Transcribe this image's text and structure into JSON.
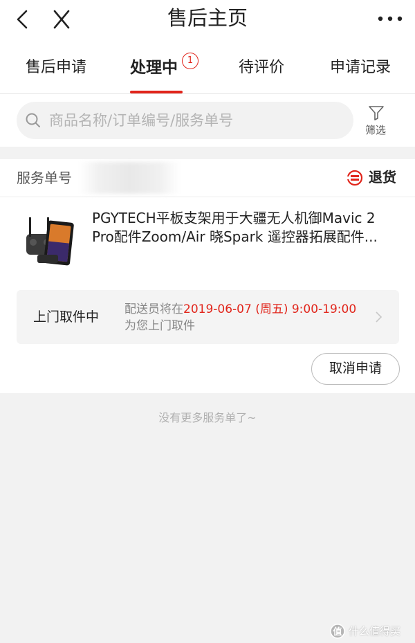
{
  "header": {
    "title": "售后主页",
    "back_icon": "chevron-left-icon",
    "close_icon": "close-icon",
    "more_icon": "more-dots-icon"
  },
  "tabs": [
    {
      "label": "售后申请",
      "active": false
    },
    {
      "label": "处理中",
      "active": true,
      "badge": "1"
    },
    {
      "label": "待评价",
      "active": false
    },
    {
      "label": "申请记录",
      "active": false
    }
  ],
  "search": {
    "placeholder": "商品名称/订单编号/服务单号",
    "filter_label": "筛选"
  },
  "service_card": {
    "service_no_label": "服务单号",
    "type_label": "退货",
    "product": {
      "title_line1": "PGYTECH平板支架用于大疆无人机御Mavic 2",
      "title_line2": "Pro配件Zoom/Air 晓Spark 遥控器拓展配件..."
    },
    "pickup": {
      "status": "上门取件中",
      "detail_prefix": "配送员将在",
      "detail_time": "2019-06-07 (周五) 9:00-19:00",
      "detail_suffix": "为您上门取件"
    },
    "cancel_label": "取消申请"
  },
  "footer": {
    "no_more_text": "没有更多服务单了~"
  },
  "watermark": {
    "text": "什么值得买"
  },
  "colors": {
    "accent": "#e1251b",
    "background": "#f2f2f2",
    "card": "#ffffff",
    "muted_text": "#888888"
  }
}
